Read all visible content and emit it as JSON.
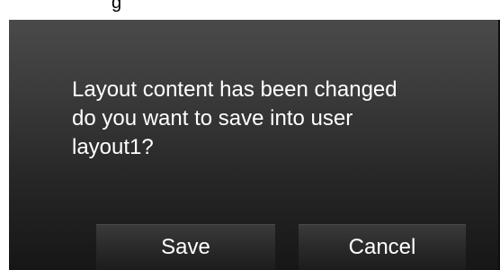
{
  "window": {
    "title_fragment": "g"
  },
  "dialog": {
    "message_lines": [
      "Layout content has been changed",
      "do you want to save into user",
      "layout1?"
    ],
    "buttons": {
      "save_label": "Save",
      "cancel_label": "Cancel"
    }
  },
  "colors": {
    "dialog_top": "#4a4a4a",
    "dialog_bottom": "#161616",
    "text": "#ffffff"
  }
}
